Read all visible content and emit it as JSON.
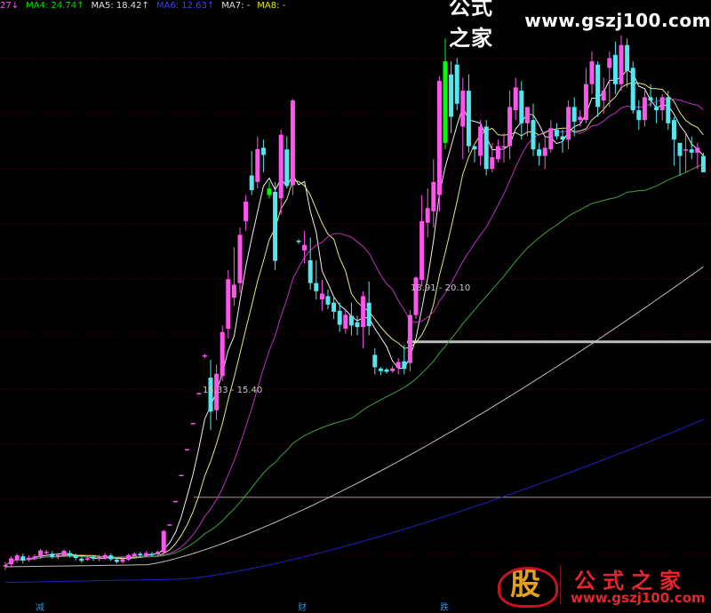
{
  "ma_legend": [
    {
      "text": "27↓",
      "color": "#ff55ff"
    },
    {
      "text": "MA4: 24.74↑",
      "color": "#00e000"
    },
    {
      "text": "MA5: 18.42↑",
      "color": "#e0e0e0"
    },
    {
      "text": "MA6: 12.63↑",
      "color": "#4040ff"
    },
    {
      "text": "MA7: -",
      "color": "#e0e0e0"
    },
    {
      "text": "MA8: -",
      "color": "#e6e600"
    }
  ],
  "watermark_top": {
    "cn": "公式之家",
    "url": "www.gszj100.com"
  },
  "watermark_bottom": {
    "seal": "股",
    "cn": "公式之家",
    "url": "www.gszj100.com"
  },
  "ranges": [
    {
      "text": "15.33 - 15.40"
    },
    {
      "text": "18.91 - 20.10"
    }
  ],
  "axis_labels": [
    "减",
    "财",
    "跌"
  ],
  "colors": {
    "up": "#ff55ee",
    "down": "#55e6ee",
    "green": "#00ff00",
    "grid": "#5a0000",
    "ma_white": "#f0f0f0",
    "ma_yellow": "#e6e680",
    "ma_magenta": "#c030c0",
    "ma_green": "#40a040",
    "ma_gray": "#bdbdbd",
    "ma_blue": "#2020c0"
  },
  "chart_data": {
    "type": "candlestick",
    "ylim": [
      12.6,
      30.2
    ],
    "candles": [
      [
        13.23,
        13.25,
        13.1,
        13.35
      ],
      [
        13.28,
        13.46,
        13.2,
        13.52
      ],
      [
        13.4,
        13.55,
        13.33,
        13.6
      ],
      [
        13.52,
        13.39,
        13.3,
        13.6
      ],
      [
        13.42,
        13.48,
        13.35,
        13.55
      ],
      [
        13.46,
        13.52,
        13.4,
        13.58
      ],
      [
        13.5,
        13.7,
        13.45,
        13.75
      ],
      [
        13.62,
        13.66,
        13.55,
        13.72
      ],
      [
        13.6,
        13.5,
        13.45,
        13.68
      ],
      [
        13.5,
        13.56,
        13.43,
        13.63
      ],
      [
        13.55,
        13.69,
        13.5,
        13.73
      ],
      [
        13.62,
        13.55,
        13.48,
        13.7
      ],
      [
        13.55,
        13.47,
        13.4,
        13.6
      ],
      [
        13.45,
        13.38,
        13.32,
        13.5
      ],
      [
        13.43,
        13.46,
        13.38,
        13.52
      ],
      [
        13.5,
        13.45,
        13.38,
        13.55
      ],
      [
        13.44,
        13.5,
        13.37,
        13.56
      ],
      [
        13.47,
        13.56,
        13.42,
        13.62
      ],
      [
        13.55,
        13.43,
        13.38,
        13.61
      ],
      [
        13.42,
        13.35,
        13.3,
        13.47
      ],
      [
        13.35,
        13.43,
        13.3,
        13.48
      ],
      [
        13.42,
        13.56,
        13.38,
        13.6
      ],
      [
        13.52,
        13.6,
        13.45,
        13.65
      ],
      [
        13.6,
        13.55,
        13.49,
        13.66
      ],
      [
        13.55,
        13.62,
        13.5,
        13.68
      ],
      [
        13.6,
        13.57,
        13.52,
        13.66
      ],
      [
        13.58,
        13.66,
        13.53,
        13.7
      ],
      [
        13.64,
        14.3,
        13.6,
        14.33
      ],
      [
        14.48,
        14.5,
        14.46,
        14.5
      ],
      [
        15.2,
        15.22,
        15.18,
        15.22
      ],
      [
        16.0,
        16.02,
        15.98,
        16.02
      ],
      [
        16.79,
        16.81,
        16.77,
        16.81
      ],
      [
        17.58,
        17.61,
        17.57,
        17.61
      ],
      [
        18.5,
        18.53,
        18.48,
        18.53
      ],
      [
        19.66,
        19.69,
        19.6,
        19.72
      ],
      [
        19.0,
        17.96,
        17.4,
        19.55
      ],
      [
        18.0,
        19.12,
        17.7,
        19.4
      ],
      [
        19.05,
        20.4,
        18.9,
        20.6
      ],
      [
        20.5,
        22.02,
        20.2,
        22.3
      ],
      [
        21.45,
        21.85,
        21.2,
        23.0
      ],
      [
        21.9,
        23.38,
        21.6,
        23.6
      ],
      [
        23.8,
        24.4,
        23.5,
        24.6
      ],
      [
        25.2,
        24.75,
        24.6,
        25.95
      ],
      [
        25.0,
        26.01,
        24.8,
        26.4
      ],
      [
        26.05,
        25.83,
        25.3,
        26.3
      ],
      [
        24.8,
        24.6,
        24.5,
        25.0
      ],
      [
        24.7,
        22.58,
        22.3,
        25.0
      ],
      [
        24.5,
        26.45,
        24.0,
        26.6
      ],
      [
        26.0,
        24.88,
        24.8,
        26.4
      ],
      [
        24.9,
        27.5,
        24.6,
        27.55
      ],
      [
        23.2,
        23.17,
        23.1,
        23.25
      ],
      [
        22.9,
        23.07,
        22.5,
        23.5
      ],
      [
        22.6,
        21.9,
        21.7,
        23.3
      ],
      [
        21.9,
        21.65,
        21.4,
        22.6
      ],
      [
        21.4,
        21.58,
        21.05,
        22.0
      ],
      [
        21.5,
        21.24,
        21.1,
        21.7
      ],
      [
        21.3,
        21.02,
        20.8,
        21.5
      ],
      [
        21.05,
        20.62,
        20.4,
        21.3
      ],
      [
        20.5,
        20.93,
        20.35,
        21.1
      ],
      [
        20.9,
        20.6,
        20.3,
        21.3
      ],
      [
        20.7,
        20.55,
        20.3,
        20.9
      ],
      [
        20.55,
        21.5,
        19.9,
        21.65
      ],
      [
        21.3,
        20.58,
        20.3,
        21.95
      ],
      [
        19.7,
        19.32,
        19.1,
        19.9
      ],
      [
        19.28,
        19.2,
        19.08,
        19.33
      ],
      [
        19.25,
        19.18,
        19.12,
        19.3
      ],
      [
        19.2,
        19.28,
        19.15,
        19.35
      ],
      [
        19.3,
        19.48,
        19.1,
        19.6
      ],
      [
        19.5,
        19.27,
        19.1,
        20.0
      ],
      [
        19.45,
        20.92,
        19.2,
        21.07
      ],
      [
        20.92,
        22.07,
        20.8,
        22.1
      ],
      [
        22.0,
        23.8,
        21.8,
        24.6
      ],
      [
        23.75,
        24.2,
        23.3,
        24.8
      ],
      [
        24.1,
        25.0,
        23.6,
        25.7
      ],
      [
        24.6,
        28.1,
        24.1,
        28.25
      ],
      [
        28.7,
        26.2,
        26.0,
        29.4
      ],
      [
        28.3,
        27.0,
        26.5,
        28.7
      ],
      [
        28.6,
        27.4,
        27.2,
        28.8
      ],
      [
        26.7,
        27.8,
        25.7,
        28.2
      ],
      [
        27.8,
        26.1,
        25.9,
        28.3
      ],
      [
        26.1,
        26.0,
        25.6,
        26.1
      ],
      [
        25.8,
        26.7,
        25.5,
        26.9
      ],
      [
        26.7,
        25.4,
        25.2,
        26.9
      ],
      [
        25.4,
        25.76,
        25.3,
        26.2
      ],
      [
        25.7,
        26.1,
        25.6,
        26.3
      ],
      [
        26.1,
        26.1,
        25.6,
        26.5
      ],
      [
        26.1,
        27.3,
        25.7,
        27.8
      ],
      [
        27.2,
        27.9,
        26.9,
        28.2
      ],
      [
        27.8,
        26.8,
        26.3,
        28.1
      ],
      [
        26.8,
        27.3,
        26.4,
        27.3
      ],
      [
        26.9,
        26.0,
        25.8,
        27.4
      ],
      [
        26.0,
        25.8,
        25.5,
        26.2
      ],
      [
        25.8,
        26.05,
        25.4,
        26.4
      ],
      [
        26.0,
        26.65,
        25.9,
        26.9
      ],
      [
        26.6,
        26.4,
        26.3,
        26.8
      ],
      [
        26.4,
        26.3,
        25.9,
        26.6
      ],
      [
        26.3,
        27.3,
        26.0,
        27.5
      ],
      [
        27.3,
        26.85,
        26.4,
        27.6
      ],
      [
        26.9,
        27.0,
        26.7,
        27.2
      ],
      [
        26.9,
        28.0,
        26.8,
        28.5
      ],
      [
        28.0,
        28.7,
        27.7,
        29.0
      ],
      [
        28.6,
        27.3,
        27.0,
        28.7
      ],
      [
        27.5,
        27.8,
        27.1,
        28.2
      ],
      [
        28.5,
        28.8,
        27.3,
        29.0
      ],
      [
        28.9,
        28.0,
        27.7,
        29.3
      ],
      [
        28.0,
        29.2,
        27.8,
        29.5
      ],
      [
        29.2,
        28.4,
        27.9,
        29.4
      ],
      [
        28.5,
        27.2,
        27.1,
        28.7
      ],
      [
        27.2,
        26.9,
        26.6,
        27.5
      ],
      [
        26.9,
        27.6,
        26.7,
        27.8
      ],
      [
        27.6,
        27.5,
        27.3,
        28.0
      ],
      [
        27.3,
        27.2,
        26.8,
        27.6
      ],
      [
        27.2,
        27.6,
        26.9,
        27.7
      ],
      [
        27.6,
        26.8,
        26.6,
        27.8
      ],
      [
        26.9,
        26.3,
        25.5,
        27.0
      ],
      [
        26.2,
        25.8,
        25.2,
        26.2
      ],
      [
        26.0,
        26.0,
        25.3,
        26.5
      ],
      [
        26.0,
        25.9,
        25.7,
        26.4
      ],
      [
        25.9,
        26.05,
        25.4,
        26.2
      ],
      [
        25.8,
        25.3,
        25.3,
        25.9
      ]
    ]
  }
}
